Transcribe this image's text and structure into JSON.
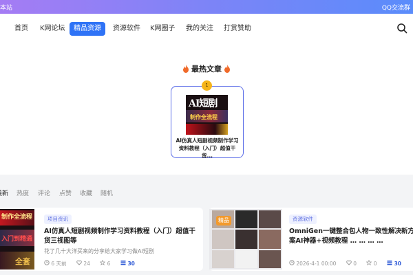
{
  "topbar": {
    "left_text": "本站",
    "right_text": "QQ交流群"
  },
  "nav": {
    "items": [
      {
        "label": "首页"
      },
      {
        "label": "K网论坛"
      },
      {
        "label": "精品资源"
      },
      {
        "label": "资源软件"
      },
      {
        "label": "K网圈子"
      },
      {
        "label": "我的关注"
      },
      {
        "label": "打赏赞助"
      }
    ],
    "active_index": 2
  },
  "hot": {
    "title": "最热文章",
    "rank": "1",
    "article_title": "AI仿真人短剧视频制作学习资料教程（入门）超值干货...",
    "thumb_text_main": "AI短剧",
    "thumb_text_sub": "制作全流程"
  },
  "tabs": [
    "最新",
    "热度",
    "评论",
    "点赞",
    "收藏",
    "随机"
  ],
  "posts": [
    {
      "tag": "项目资讯",
      "title": "AI仿真人短剧视频制作学习资料教程（入门）超值干货三视图等",
      "desc": "花了几十大洋买来的分享给大家学习做AI短剧",
      "time": "6 天前",
      "likes": "24",
      "stars": "6",
      "hot": "30",
      "thumb_top": "制作全流程",
      "thumb_mid": "入门到精通",
      "thumb_bottom": "全套"
    },
    {
      "tag": "资源软件",
      "badge": "精品",
      "title": "OmniGen一键整合包人物一致性解决新方案AI神器+视频教程 … … … …",
      "time": "2026-4-1 00:00",
      "likes": "0",
      "stars": "0",
      "hot": "30"
    }
  ],
  "colors": {
    "accent": "#2f73f6",
    "badge": "#f39a2c",
    "rank": "#f5b41b"
  }
}
